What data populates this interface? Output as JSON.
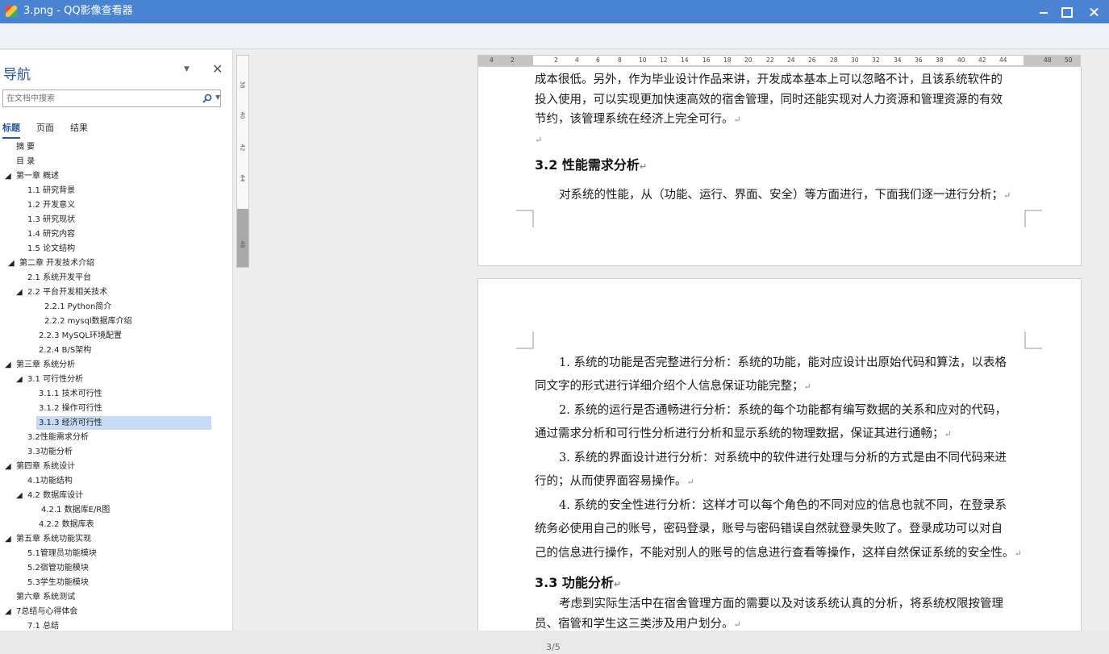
{
  "window": {
    "title": "3.png - QQ影像查看器"
  },
  "nav": {
    "title": "导航",
    "search_placeholder": "在文档中搜索",
    "tabs": [
      "标题",
      "页面",
      "结果"
    ],
    "items": [
      "摘  要",
      "目  录",
      "第一章 概述",
      "1.1 研究背景",
      "1.2 开发意义",
      "1.3 研究现状",
      "1.4 研究内容",
      "1.5 论文结构",
      "第二章 开发技术介绍",
      "2.1 系统开发平台",
      "2.2 平台开发相关技术",
      "2.2.1  Python简介",
      "2.2.2  mysql数据库介绍",
      "2.2.3  MySQL环境配置",
      "2.2.4  B/S架构",
      "第三章 系统分析",
      "3.1 可行性分析",
      "3.1.1 技术可行性",
      "3.1.2 操作可行性",
      "3.1.3 经济可行性",
      "3.2性能需求分析",
      "3.3功能分析",
      "第四章 系统设计",
      "4.1功能结构",
      "4.2 数据库设计",
      "4.2.1 数据库E/R图",
      "4.2.2 数据库表",
      "第五章 系统功能实现",
      "5.1管理员功能模块",
      "5.2宿管功能模块",
      "5.3学生功能模块",
      "第六章 系统测试",
      "7总结与心得体会",
      "7.1 总结"
    ]
  },
  "ruler": {
    "h_ticks": [
      "4",
      "2",
      "2",
      "4",
      "6",
      "8",
      "10",
      "12",
      "14",
      "16",
      "18",
      "20",
      "22",
      "24",
      "26",
      "28",
      "30",
      "32",
      "34",
      "36",
      "38",
      "40",
      "42",
      "44",
      "48",
      "50"
    ],
    "v_ticks": [
      "38",
      "40",
      "42",
      "44",
      "48"
    ]
  },
  "doc": {
    "page1_lines": [
      "成本很低。另外，作为毕业设计作品来讲，开发成本基本上可以忽略不计，且该系统软件的",
      "投入使用，可以实现更加快速高效的宿舍管理，同时还能实现对人力资源和管理资源的有效",
      "节约，该管理系统在经济上完全可行。"
    ],
    "h_3_2": "3.2 性能需求分析",
    "p_3_2": "对系统的性能，从（功能、运行、界面、安全）等方面进行，下面我们逐一进行分析；",
    "item1_a": "1. 系统的功能是否完整进行分析：系统的功能，能对应设计出原始代码和算法，以表格",
    "item1_b": "同文字的形式进行详细介绍个人信息保证功能完整；",
    "item2_a": "2. 系统的运行是否通畅进行分析：系统的每个功能都有编写数据的关系和应对的代码，",
    "item2_b": "通过需求分析和可行性分析进行分析和显示系统的物理数据，保证其进行通畅；",
    "item3_a": "3. 系统的界面设计进行分析：对系统中的软件进行处理与分析的方式是由不同代码来进",
    "item3_b": "行的；从而使界面容易操作。",
    "item4_a": "4. 系统的安全性进行分析：这样才可以每个角色的不同对应的信息也就不同，在登录系",
    "item4_b": "统务必使用自己的账号，密码登录，账号与密码错误自然就登录失败了。登录成功可以对自",
    "item4_c": "己的信息进行操作，不能对别人的账号的信息进行查看等操作，这样自然保证系统的安全性。",
    "h_3_3": "3.3 功能分析",
    "p_3_3_a": "考虑到实际生活中在宿舍管理方面的需要以及对该系统认真的分析，将系统权限按管理",
    "p_3_3_b": "员、宿管和学生这三类涉及用户划分。",
    "para_mark": "↵"
  },
  "status": {
    "page_counter": "3/5"
  }
}
